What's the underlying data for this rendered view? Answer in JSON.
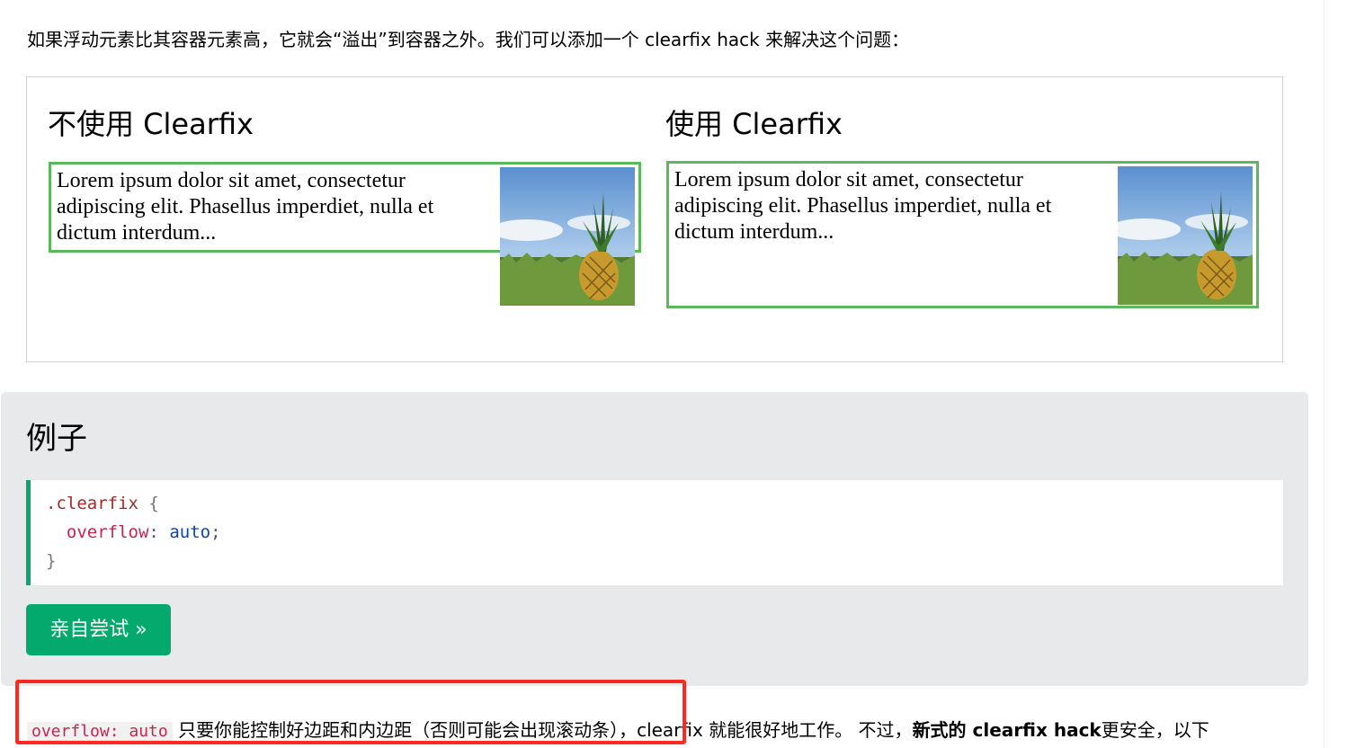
{
  "intro_text": "如果浮动元素比其容器元素高，它就会“溢出”到容器之外。我们可以添加一个 clearfix hack 来解决这个问题：",
  "demo": {
    "left_heading": "不使用 Clearfix",
    "right_heading": "使用 Clearfix",
    "lorem_text": "Lorem ipsum dolor sit amet, consectetur adipiscing elit. Phasellus imperdiet, nulla et dictum interdum...",
    "border_color": "#5cb85c"
  },
  "example": {
    "title": "例子",
    "code": {
      "selector": ".clearfix",
      "open_brace": " {",
      "property": "overflow",
      "colon": ":",
      "value": "auto",
      "semicolon": ";",
      "close_brace": "}"
    },
    "try_button_label": "亲自尝试 »",
    "accent_color": "#04aa6d"
  },
  "bottom": {
    "code": "overflow: auto",
    "text_1": " 只要你能控制好边距和内边距（否则可能会出现滚动条），clearfix 就能很好地工作。 不过，",
    "bold_text": "新式的 clearfix hack",
    "text_2": "更安全，以下"
  },
  "highlight_color": "#ff2a1f"
}
